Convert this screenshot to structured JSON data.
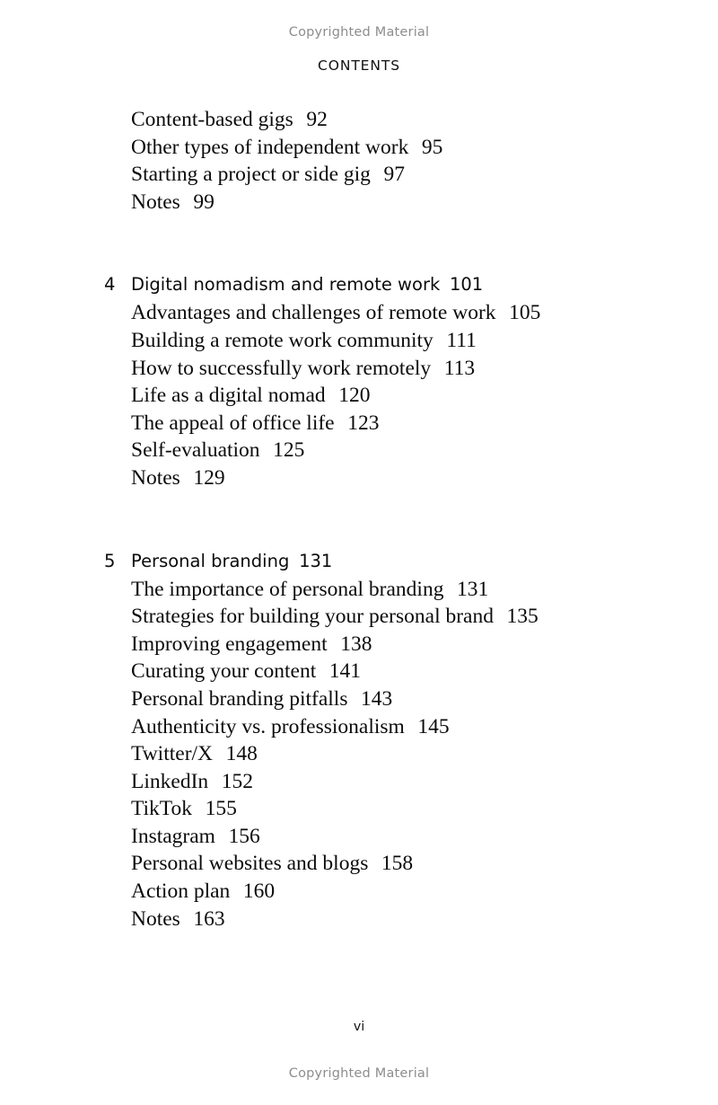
{
  "watermark": {
    "top": "Copyrighted Material",
    "bottom": "Copyrighted Material"
  },
  "running_head": "CONTENTS",
  "folio": "vi",
  "toc": {
    "groups": [
      {
        "chapter": null,
        "entries": [
          {
            "title": "Content-based gigs",
            "page": "92"
          },
          {
            "title": "Other types of independent work",
            "page": "95"
          },
          {
            "title": "Starting a project or side gig",
            "page": "97"
          },
          {
            "title": "Notes",
            "page": "99"
          }
        ]
      },
      {
        "chapter": {
          "number": "4",
          "title": "Digital nomadism and remote work",
          "page": "101"
        },
        "entries": [
          {
            "title": "Advantages and challenges of remote work",
            "page": "105"
          },
          {
            "title": "Building a remote work community",
            "page": "111"
          },
          {
            "title": "How to successfully work remotely",
            "page": "113"
          },
          {
            "title": "Life as a digital nomad",
            "page": "120"
          },
          {
            "title": "The appeal of office life",
            "page": "123"
          },
          {
            "title": "Self-evaluation",
            "page": "125"
          },
          {
            "title": "Notes",
            "page": "129"
          }
        ]
      },
      {
        "chapter": {
          "number": "5",
          "title": "Personal branding",
          "page": "131"
        },
        "entries": [
          {
            "title": "The importance of personal branding",
            "page": "131"
          },
          {
            "title": "Strategies for building your personal brand",
            "page": "135"
          },
          {
            "title": "Improving engagement",
            "page": "138"
          },
          {
            "title": "Curating your content",
            "page": "141"
          },
          {
            "title": "Personal branding pitfalls",
            "page": "143"
          },
          {
            "title": "Authenticity vs. professionalism",
            "page": "145"
          },
          {
            "title": "Twitter/X",
            "page": "148"
          },
          {
            "title": "LinkedIn",
            "page": "152"
          },
          {
            "title": "TikTok",
            "page": "155"
          },
          {
            "title": "Instagram",
            "page": "156"
          },
          {
            "title": "Personal websites and blogs",
            "page": "158"
          },
          {
            "title": "Action plan",
            "page": "160"
          },
          {
            "title": "Notes",
            "page": "163"
          }
        ]
      }
    ]
  }
}
